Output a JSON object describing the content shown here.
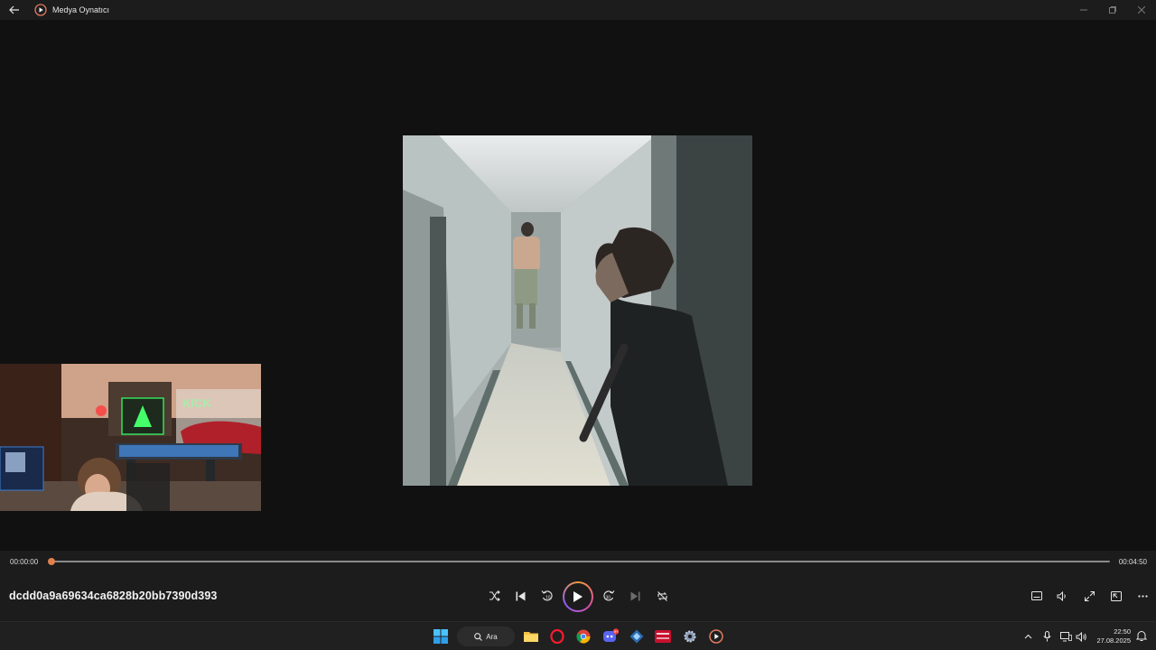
{
  "window": {
    "title": "Medya Oynatıcı"
  },
  "player": {
    "elapsed": "00:00:00",
    "total": "00:04:50",
    "progress": 0.0,
    "media_title": "dcdd0a9a69634ca6828b20bb7390d393"
  },
  "taskbar": {
    "search_label": "Ara",
    "time": "22:50",
    "date": "27.08.2025",
    "discord_badge": "9+"
  },
  "colors": {
    "accent": "#e0804f",
    "background": "#111111",
    "panel": "#1c1c1c"
  },
  "icons": {
    "back": "back-arrow-icon",
    "shuffle": "shuffle-icon",
    "previous": "previous-track-icon",
    "rewind": "rewind-10-icon",
    "play": "play-icon",
    "forward": "forward-30-icon",
    "next": "next-track-icon",
    "repeat": "repeat-off-icon",
    "subtitles": "subtitles-icon",
    "volume": "volume-icon",
    "fullscreen": "fullscreen-icon",
    "miniplayer": "miniplayer-icon",
    "more": "more-icon"
  }
}
